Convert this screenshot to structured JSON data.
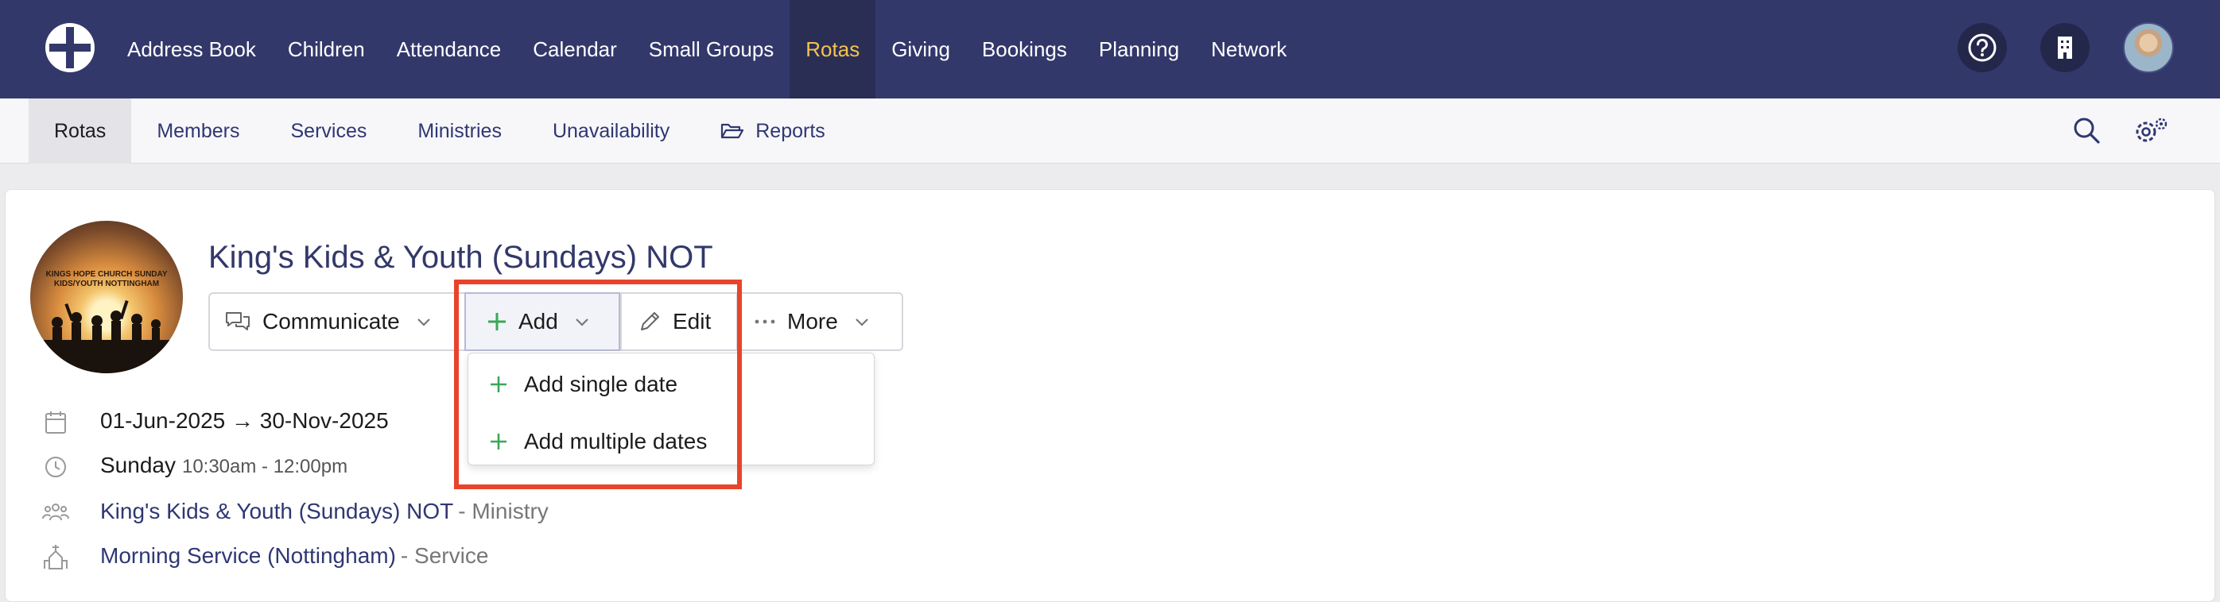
{
  "top_nav": {
    "items": [
      {
        "label": "Address Book"
      },
      {
        "label": "Children"
      },
      {
        "label": "Attendance"
      },
      {
        "label": "Calendar"
      },
      {
        "label": "Small Groups"
      },
      {
        "label": "Rotas",
        "active": true
      },
      {
        "label": "Giving"
      },
      {
        "label": "Bookings"
      },
      {
        "label": "Planning"
      },
      {
        "label": "Network"
      }
    ],
    "icons": [
      "help-icon",
      "building-icon",
      "user-avatar"
    ]
  },
  "sub_nav": {
    "items": [
      {
        "label": "Rotas",
        "active": true
      },
      {
        "label": "Members"
      },
      {
        "label": "Services"
      },
      {
        "label": "Ministries"
      },
      {
        "label": "Unavailability"
      },
      {
        "label": "Reports",
        "icon": "folder-open-icon"
      }
    ],
    "icons": [
      "search-icon",
      "settings-icon"
    ]
  },
  "rota": {
    "image_text": "KINGS HOPE CHURCH SUNDAY KIDS/YOUTH NOTTINGHAM",
    "title": "King's Kids & Youth (Sundays) NOT",
    "actions": {
      "communicate": "Communicate",
      "add": "Add",
      "edit": "Edit",
      "more": "More"
    },
    "add_menu": {
      "single": "Add single date",
      "multiple": "Add multiple dates"
    },
    "details": {
      "date_range": "01-Jun-2025 → 30-Nov-2025",
      "day": "Sunday",
      "time": "10:30am - 12:00pm",
      "ministry_name": "King's Kids & Youth (Sundays) NOT",
      "ministry_suffix": "- Ministry",
      "service_name": "Morning Service (Nottingham)",
      "service_suffix": "- Service"
    }
  },
  "colors": {
    "nav_bg": "#33386b",
    "active_nav": "#f5c24c",
    "link": "#2f3773",
    "plus_green": "#3aa757",
    "highlight": "#e8442b"
  }
}
